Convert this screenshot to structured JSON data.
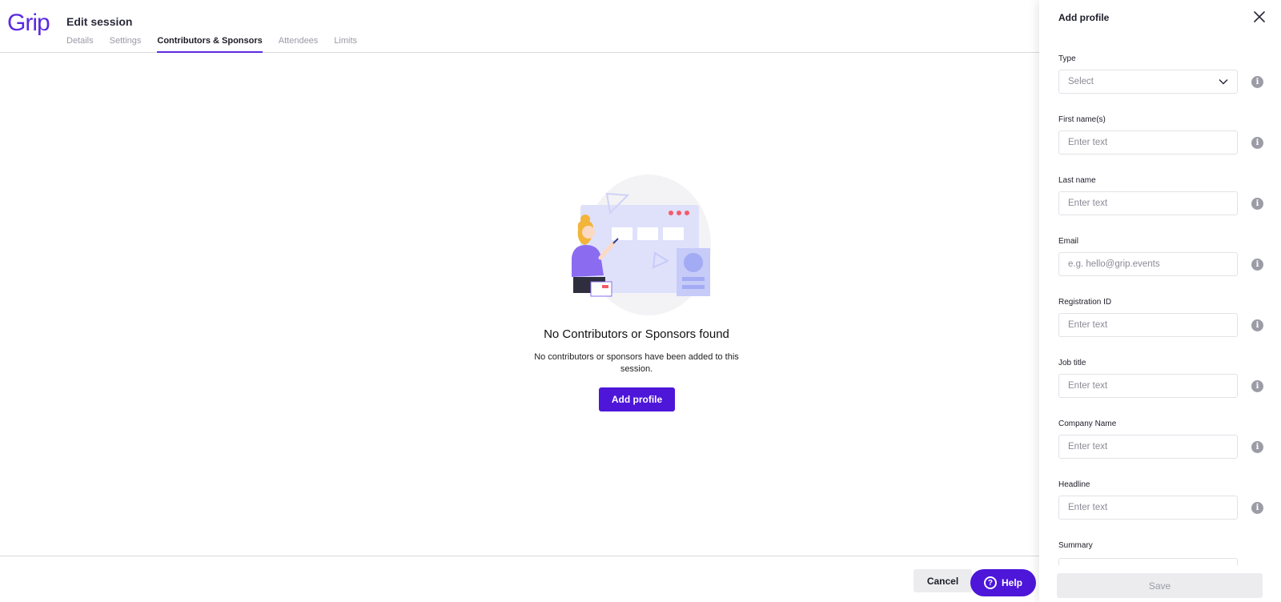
{
  "app": {
    "logo_text": "Grip",
    "brand_color": "#4d16d9"
  },
  "header": {
    "title": "Edit session",
    "tabs": [
      {
        "label": "Details",
        "active": false
      },
      {
        "label": "Settings",
        "active": false
      },
      {
        "label": "Contributors & Sponsors",
        "active": true
      },
      {
        "label": "Attendees",
        "active": false
      },
      {
        "label": "Limits",
        "active": false
      }
    ]
  },
  "empty_state": {
    "illustration": "person-presenting-board-illustration",
    "title": "No Contributors or Sponsors found",
    "description": "No contributors or sponsors have been added to this session.",
    "button_label": "Add profile"
  },
  "footer": {
    "cancel_label": "Cancel",
    "help_label": "Help",
    "help_icon": "question-circle-icon"
  },
  "panel": {
    "title": "Add profile",
    "close_icon": "close-icon",
    "fields": [
      {
        "label": "Type",
        "kind": "select",
        "value": "Select"
      },
      {
        "label": "First name(s)",
        "kind": "text",
        "placeholder": "Enter text"
      },
      {
        "label": "Last name",
        "kind": "text",
        "placeholder": "Enter text"
      },
      {
        "label": "Email",
        "kind": "text",
        "placeholder": "e.g. hello@grip.events"
      },
      {
        "label": "Registration ID",
        "kind": "text",
        "placeholder": "Enter text"
      },
      {
        "label": "Job title",
        "kind": "text",
        "placeholder": "Enter text"
      },
      {
        "label": "Company Name",
        "kind": "text",
        "placeholder": "Enter text"
      },
      {
        "label": "Headline",
        "kind": "text",
        "placeholder": "Enter text"
      },
      {
        "label": "Summary",
        "kind": "text",
        "placeholder": ""
      }
    ],
    "save_label": "Save"
  }
}
